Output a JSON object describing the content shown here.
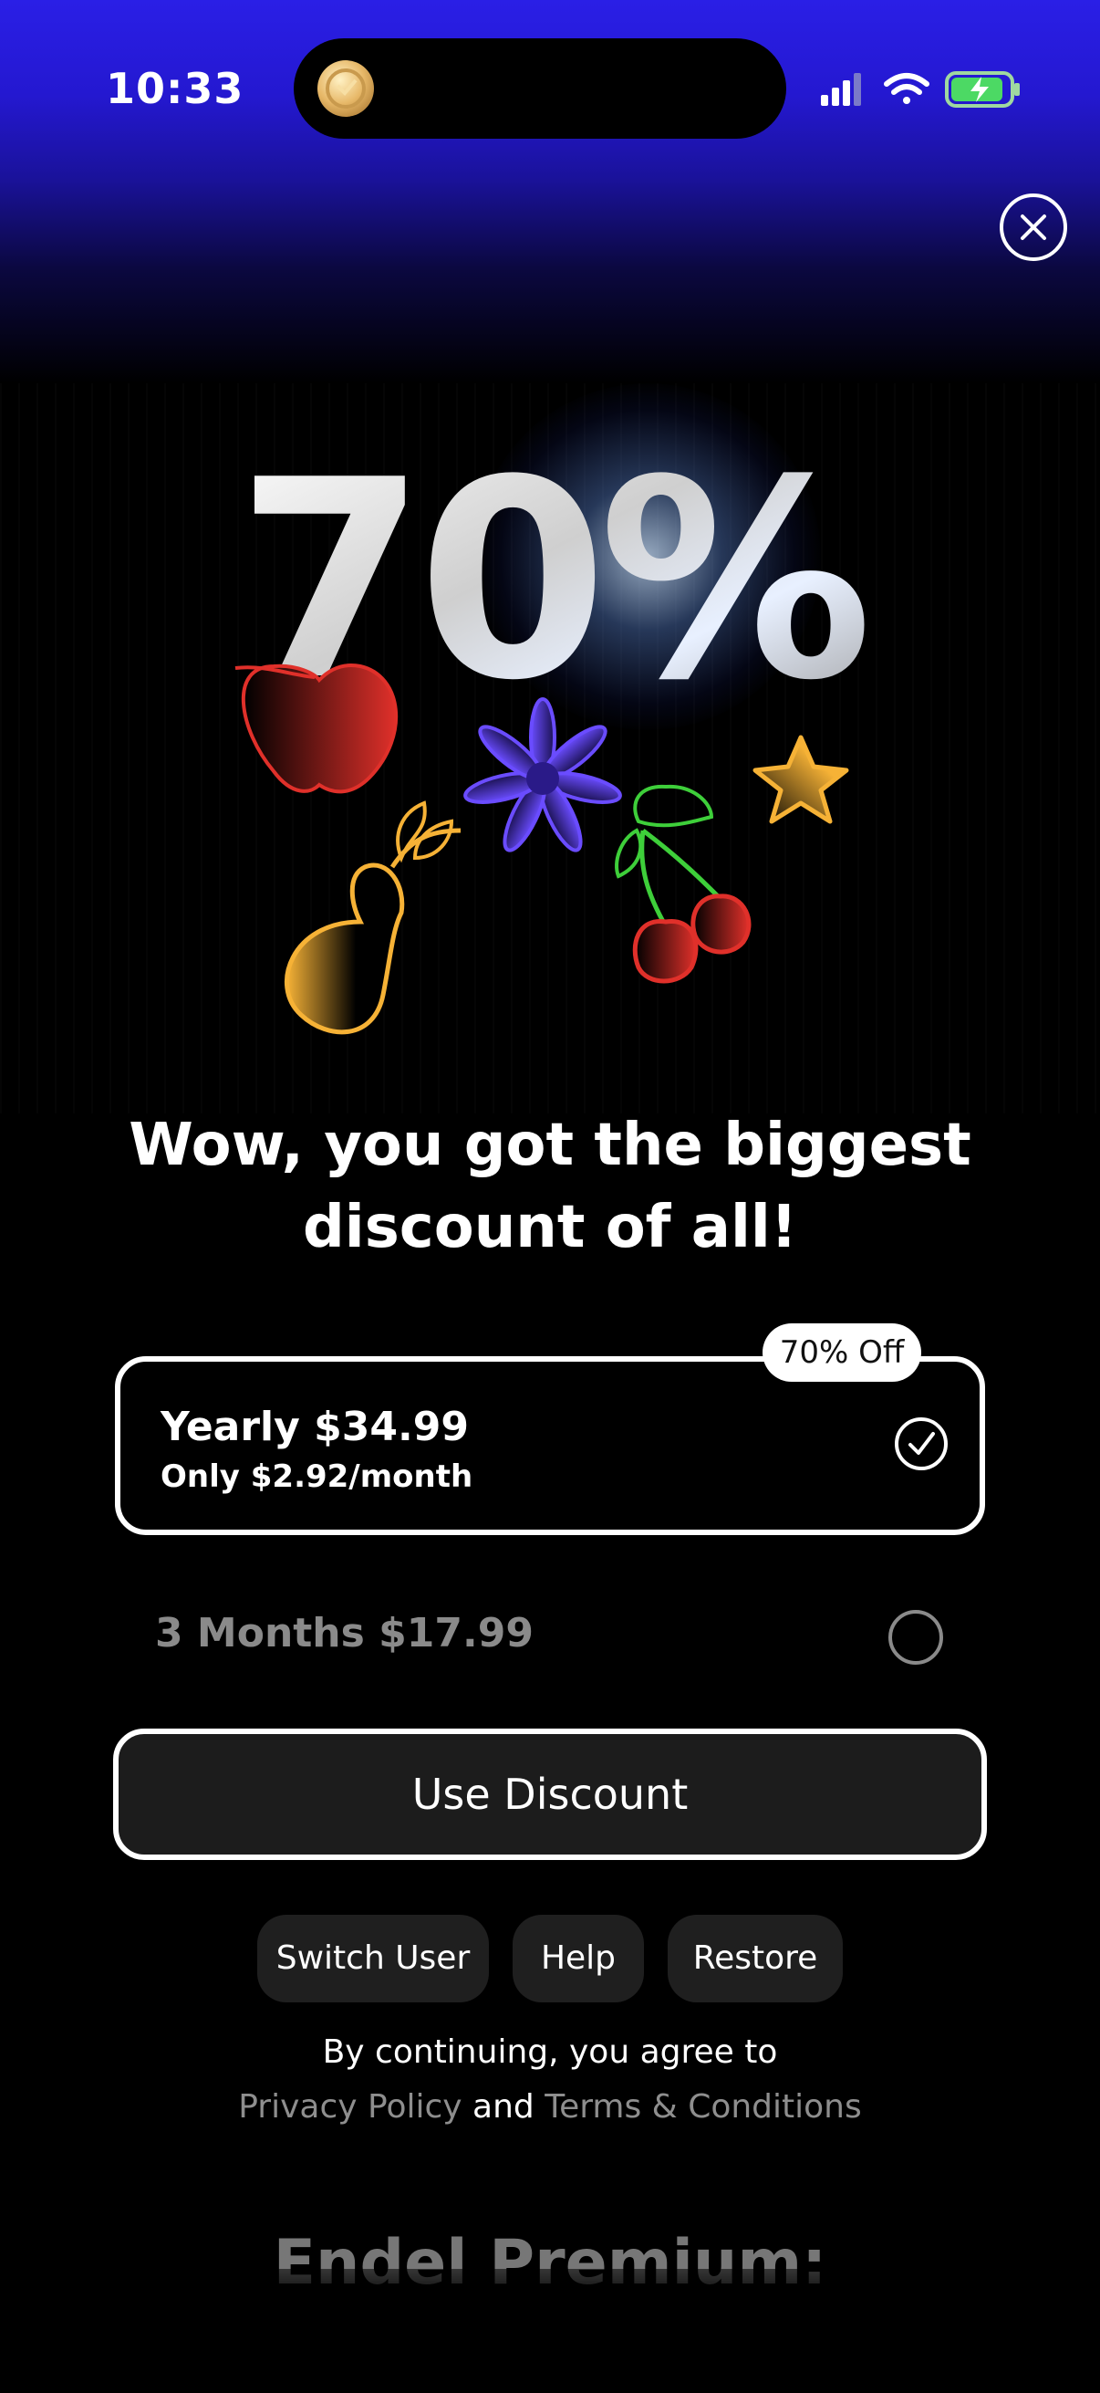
{
  "status_bar": {
    "time": "10:33",
    "icons": [
      "signal-icon",
      "wifi-icon",
      "battery-charging-icon"
    ],
    "island_icon": "coin-icon"
  },
  "close_icon": "close-icon",
  "hero": {
    "discount_text": "70%",
    "decorations": [
      "apple-icon",
      "flower-icon",
      "star-icon",
      "pear-icon",
      "cherries-icon"
    ]
  },
  "headline": {
    "line1": "Wow, you got the biggest",
    "line2": "discount of all!"
  },
  "plans": [
    {
      "title": "Yearly $34.99",
      "subtitle": "Only $2.92/month",
      "badge": "70% Off",
      "selected": true
    },
    {
      "title": "3 Months $17.99",
      "selected": false
    }
  ],
  "cta": {
    "label": "Use Discount"
  },
  "secondary_buttons": {
    "switch_user": "Switch User",
    "help": "Help",
    "restore": "Restore"
  },
  "legal": {
    "line1": "By continuing, you agree to",
    "privacy": "Privacy Policy",
    "and": "and",
    "terms": "Terms & Conditions"
  },
  "footer": {
    "title": "Endel Premium:"
  },
  "colors": {
    "background_top": "#2a1fe6",
    "background": "#000000",
    "muted": "#8a8a8a",
    "button_fill": "#1c1c1c",
    "red": "#e0302a",
    "purple": "#6a4cff",
    "yellow": "#f6b236",
    "green": "#3ecf3a"
  }
}
